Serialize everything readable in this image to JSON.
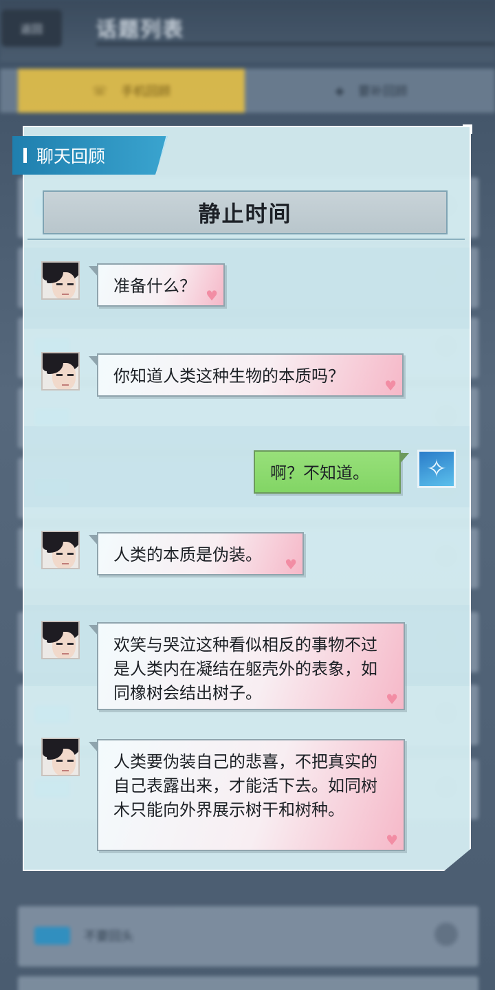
{
  "background": {
    "back_label": "返回",
    "title": "话题列表",
    "tab_active": "手机回顾",
    "tab_inactive": "要补回顾",
    "row_texts": [
      "",
      "",
      "",
      "",
      "",
      "",
      "",
      "",
      "",
      "不要回头"
    ]
  },
  "panel": {
    "badge": "聊天回顾",
    "chapter_title": "静止时间",
    "messages": [
      {
        "sender": "npc",
        "text": "准备什么？"
      },
      {
        "sender": "npc",
        "text": "你知道人类这种生物的本质吗？"
      },
      {
        "sender": "player",
        "text": "啊？不知道。"
      },
      {
        "sender": "npc",
        "text": "人类的本质是伪装。"
      },
      {
        "sender": "npc",
        "text": "欢笑与哭泣这种看似相反的事物不过是人类内在凝结在躯壳外的表象，如同橡树会结出树子。"
      },
      {
        "sender": "npc",
        "text": "人类要伪装自己的悲喜，不把真实的自己表露出来，才能活下去。如同树木只能向外界展示树干和树种。"
      }
    ]
  },
  "icons": {
    "heart": "heart-icon",
    "player_avatar": "butterfly-icon",
    "gear": "gear-icon"
  },
  "colors": {
    "npc_bubble_accent": "#f6b8c8",
    "player_bubble": "#8ad96d",
    "badge": "#2a8fc0",
    "panel": "#d6eef2"
  }
}
